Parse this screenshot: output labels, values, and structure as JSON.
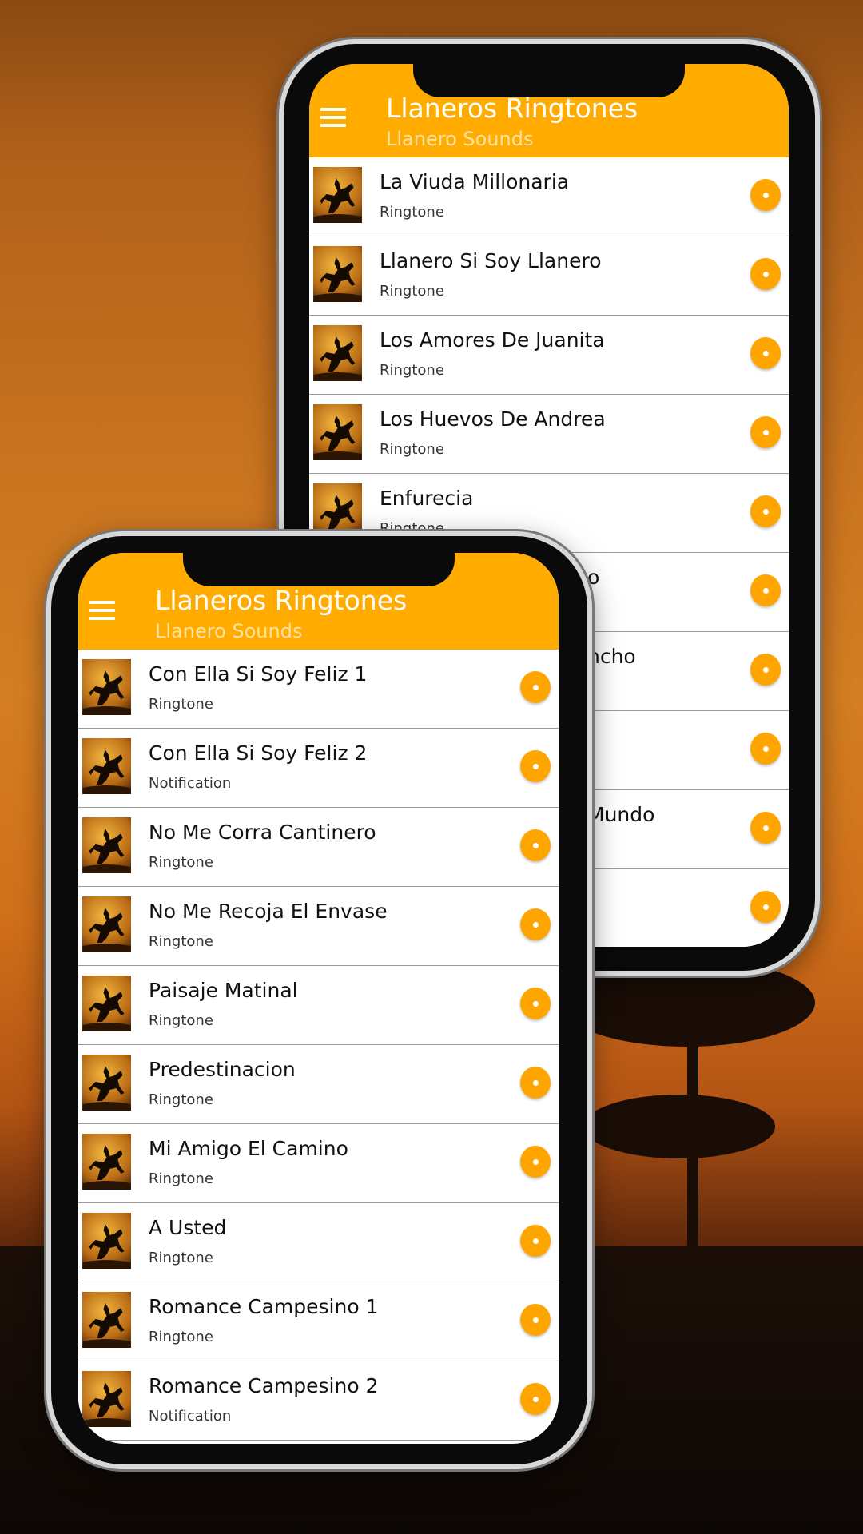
{
  "colors": {
    "accent": "#ffab00",
    "play": "#ffa500"
  },
  "back_phone": {
    "app_title": "Llaneros Ringtones",
    "app_subtitle": "Llanero Sounds",
    "items": [
      {
        "title": "La Viuda Millonaria",
        "type": "Ringtone"
      },
      {
        "title": "Llanero Si Soy Llanero",
        "type": "Ringtone"
      },
      {
        "title": "Los Amores De Juanita",
        "type": "Ringtone"
      },
      {
        "title": "Los Huevos De Andrea",
        "type": "Ringtone"
      },
      {
        "title": "Enfurecia",
        "type": "Ringtone"
      },
      {
        "title": "o",
        "type": ""
      },
      {
        "title": "ncho",
        "type": ""
      },
      {
        "title": "",
        "type": ""
      },
      {
        "title": "Mundo",
        "type": ""
      },
      {
        "title": "",
        "type": ""
      }
    ]
  },
  "front_phone": {
    "app_title": "Llaneros Ringtones",
    "app_subtitle": "Llanero Sounds",
    "items": [
      {
        "title": "Con Ella Si Soy Feliz 1",
        "type": "Ringtone"
      },
      {
        "title": "Con Ella Si Soy Feliz 2",
        "type": "Notification"
      },
      {
        "title": "No Me Corra Cantinero",
        "type": "Ringtone"
      },
      {
        "title": "No Me Recoja El Envase",
        "type": "Ringtone"
      },
      {
        "title": "Paisaje Matinal",
        "type": "Ringtone"
      },
      {
        "title": "Predestinacion",
        "type": "Ringtone"
      },
      {
        "title": "Mi Amigo El Camino",
        "type": "Ringtone"
      },
      {
        "title": "A Usted",
        "type": "Ringtone"
      },
      {
        "title": "Romance Campesino 1",
        "type": "Ringtone"
      },
      {
        "title": "Romance Campesino 2",
        "type": "Notification"
      }
    ]
  }
}
